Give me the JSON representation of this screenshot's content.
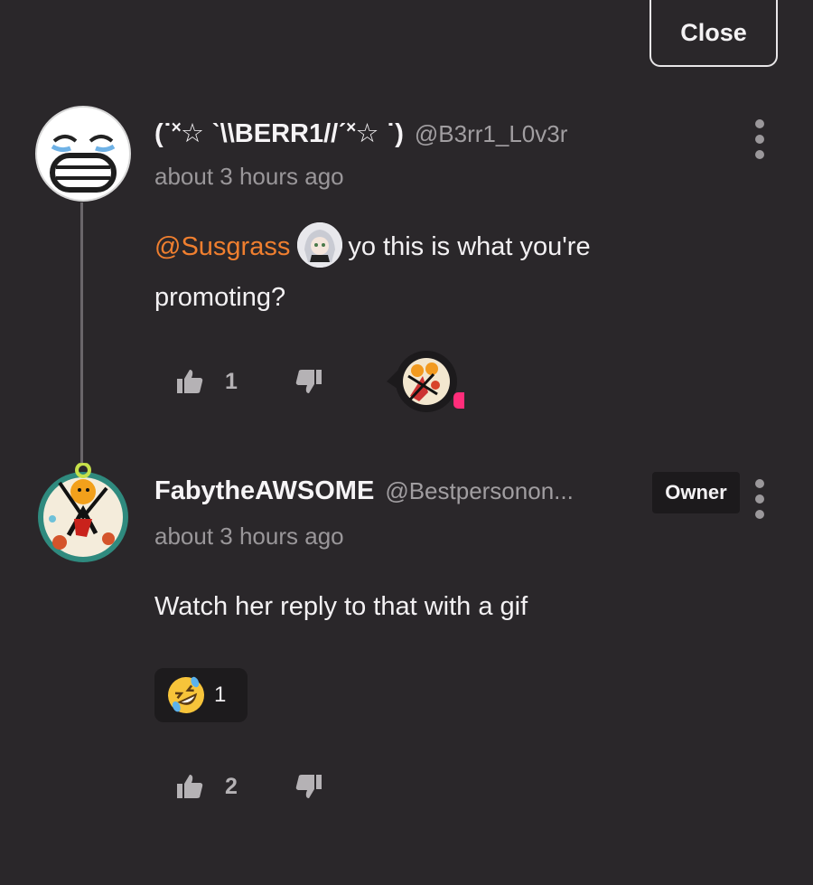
{
  "header": {
    "close_label": "Close"
  },
  "comments": [
    {
      "display_name": "(˙˟☆ ˋ\\\\BERR1//ˊ˟☆ ˙)",
      "handle": "@B3rr1_L0v3r",
      "timestamp": "about 3 hours ago",
      "mention": "@Susgrass",
      "text_after_mention": "yo this is what you're",
      "text_line2": "promoting?",
      "upvotes": "1"
    },
    {
      "display_name": "FabytheAWSOME",
      "handle": "@Bestpersonon...",
      "badge": "Owner",
      "timestamp": "about 3 hours ago",
      "text": "Watch her reply to that with a gif",
      "reaction_emoji": "rolling-on-floor-laughing",
      "reaction_count": "1",
      "upvotes": "2"
    }
  ],
  "colors": {
    "background": "#2a272a",
    "mention": "#f07f2f",
    "notification_dot": "#ff2d7a",
    "muted_text": "#9a979a"
  }
}
